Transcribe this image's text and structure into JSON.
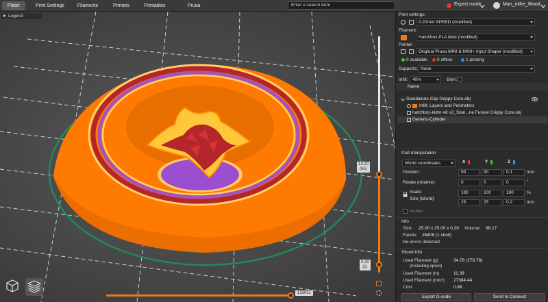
{
  "tabs": [
    {
      "label": "Plater",
      "active": true
    },
    {
      "label": "Print Settings"
    },
    {
      "label": "Filaments"
    },
    {
      "label": "Printers"
    },
    {
      "label": "Printables"
    },
    {
      "label": "Prusa Connect"
    }
  ],
  "search": {
    "placeholder": "Enter a search term"
  },
  "mode": {
    "label": "Expert mode",
    "color": "#e8332b"
  },
  "user": {
    "name": "Man_inthe_Wood"
  },
  "viewport": {
    "legend_label": "Legend",
    "layer_top": {
      "height": "13.00",
      "layer": "(65)"
    },
    "layer_bottom": {
      "height": "0.20",
      "layer": "(1)"
    },
    "move_value": "133051"
  },
  "colors": {
    "accent": "#f07a14",
    "wall": "#ff7a00",
    "infill": "#b5262b",
    "support": "#9b4fcf",
    "skirt": "#1f8a5b"
  },
  "panel": {
    "print_settings_label": "Print settings:",
    "print_settings_value": "0.20mm SPEED (modified)",
    "filament_label": "Filament:",
    "filament_value": "Hatchbox PLA Mod (modified)",
    "printer_label": "Printer:",
    "printer_value": "Original Prusa MINI & MINI+ Input Shaper (modified)",
    "status": [
      {
        "count": "0",
        "label": "available",
        "color": "#3ec243"
      },
      {
        "count": "0",
        "label": "offline",
        "color": "#e8332b"
      },
      {
        "count": "1",
        "label": "printing",
        "color": "#3a8fd8"
      }
    ],
    "supports_label": "Supports:",
    "supports_value": "None",
    "infill_label": "Infill:",
    "infill_value": "40%",
    "brim_label": "Brim:",
    "list_header": "Name",
    "objects": {
      "root": "Standalone Cap Grippy Core.obj",
      "child1": "Infill; Layers and Perimeters",
      "child2": "hatchbox-kidnr-v8 v2_Stan...ne Funnel Grippy Core.obj",
      "child3": "Generic-Cylinder"
    },
    "part_manipulation_title": "Part manipulation",
    "coord_system": "World coordinates",
    "axes": [
      "X",
      "Y",
      "Z"
    ],
    "position_label": "Position:",
    "position": [
      "90",
      "90",
      "0.1"
    ],
    "rotate_label": "Rotate (relative):",
    "rotate": [
      "0",
      "0",
      "0"
    ],
    "scale_label": "Scale:",
    "scale": [
      "100",
      "100",
      "100"
    ],
    "size_label": "Size [World]:",
    "size": [
      "25",
      "25",
      "0.2"
    ],
    "unit_mm": "mm",
    "unit_deg": "°",
    "unit_pct": "%",
    "inches_label": "Inches",
    "info_title": "Info",
    "info_size_label": "Size:",
    "info_size_value": "25.00 x 25.00 x 0.20",
    "info_volume_label": "Volume:",
    "info_volume_value": "98.17",
    "info_facets_label": "Facets:",
    "info_facets_value": "26408 (1 shell)",
    "info_errors": "No errors detected",
    "sliced_title": "Sliced Info",
    "sliced_rows": [
      {
        "label": "Used Filament (g)",
        "sub": "(including spool)",
        "value": "34.78 (279.78)"
      },
      {
        "label": "Used Filament (m)",
        "value": "11.39"
      },
      {
        "label": "Used Filament (mm³)",
        "value": "27384.44"
      },
      {
        "label": "Cost",
        "value": "0.88"
      }
    ],
    "export_button": "Export G-code",
    "send_button": "Send to Connect"
  }
}
